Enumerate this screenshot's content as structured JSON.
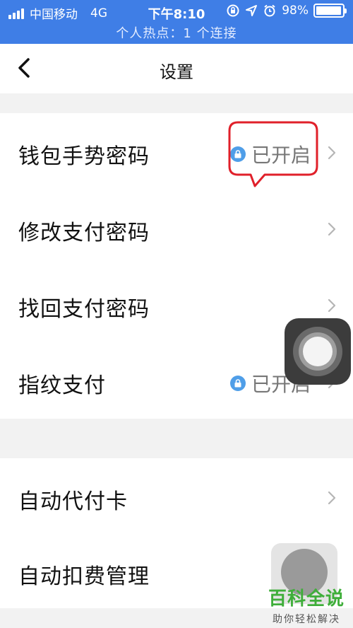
{
  "status_bar": {
    "carrier": "中国移动",
    "network": "4G",
    "time": "下午8:10",
    "battery_percent": "98%",
    "battery_level": 0.98,
    "hotspot_text": "个人热点：1 个连接"
  },
  "nav": {
    "title": "设置"
  },
  "settings": {
    "group1": [
      {
        "label": "钱包手势密码",
        "status": "已开启"
      },
      {
        "label": "修改支付密码"
      },
      {
        "label": "找回支付密码"
      },
      {
        "label": "指纹支付",
        "status": "已开启"
      }
    ],
    "group2": [
      {
        "label": "自动代付卡"
      },
      {
        "label": "自动扣费管理"
      }
    ]
  },
  "watermark": {
    "title": "百科全说",
    "subtitle": "助你轻松解决"
  },
  "colors": {
    "status_bar_bg": "#3f7ee6",
    "lock_icon": "#4f9ee8",
    "highlight": "#e0202a",
    "watermark_green": "#3fae3a"
  },
  "icons": {
    "back": "chevron-left-icon",
    "row_arrow": "chevron-right-icon",
    "status_lock": "lock-icon"
  }
}
